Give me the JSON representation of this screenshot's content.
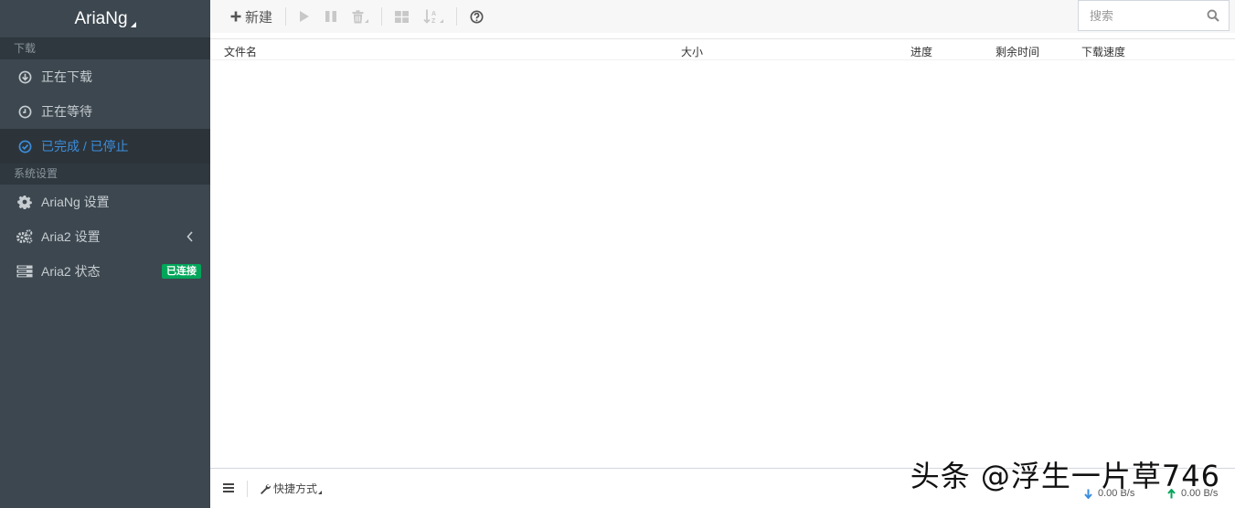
{
  "app": {
    "title": "AriaNg"
  },
  "sidebar": {
    "section_download": "下载",
    "section_settings": "系统设置",
    "items": [
      {
        "label": "正在下载",
        "icon": "download-circle-icon"
      },
      {
        "label": "正在等待",
        "icon": "clock-icon"
      },
      {
        "label": "已完成 / 已停止",
        "icon": "check-circle-icon",
        "active": true
      },
      {
        "label": "AriaNg 设置",
        "icon": "gear-icon"
      },
      {
        "label": "Aria2 设置",
        "icon": "gears-icon"
      },
      {
        "label": "Aria2 状态",
        "icon": "server-icon",
        "badge": "已连接"
      }
    ]
  },
  "toolbar": {
    "new_label": "新建",
    "search_placeholder": "搜索"
  },
  "table": {
    "columns": [
      "文件名",
      "大小",
      "进度",
      "剩余时间",
      "下载速度"
    ]
  },
  "footer": {
    "shortcut_label": "快捷方式",
    "download_speed": "0.00 B/s",
    "upload_speed": "0.00 B/s"
  },
  "watermark": "头条 @浮生一片草746",
  "colors": {
    "sidebar_bg": "#3c474f",
    "active": "#3c8ddc",
    "badge": "#00a65a"
  }
}
